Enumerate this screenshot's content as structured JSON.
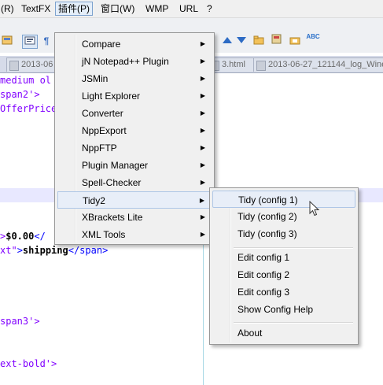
{
  "menubar": {
    "items": [
      "(R)",
      "TextFX",
      "插件(P)",
      "窗口(W)",
      "WMP",
      "URL",
      "?"
    ]
  },
  "toolbar": {
    "icons": [
      "save-all-icon",
      "print-icon",
      "paragraph-icon",
      "find-prev-icon",
      "find-next-icon",
      "folder-icon",
      "save-icon",
      "spellcheck-icon"
    ],
    "spellcheck_text": "ABC"
  },
  "tabs": [
    {
      "label": "2013-06"
    },
    {
      "label": "3.html"
    },
    {
      "label": "2013-06-27_121144_log_Wine"
    }
  ],
  "editor": {
    "lines": [
      {
        "parts": [
          {
            "text": "medium ol",
            "style": "purple"
          }
        ]
      },
      {
        "parts": [
          {
            "text": "span2'>",
            "style": "purple"
          }
        ]
      },
      {
        "parts": [
          {
            "text": "OfferPrice",
            "style": "purple"
          }
        ]
      },
      {
        "parts": [
          {
            "text": "",
            "style": "purple"
          }
        ]
      },
      {
        "parts": [
          {
            "text": "",
            "style": "purple"
          }
        ]
      },
      {
        "parts": [
          {
            "text": "",
            "style": "purple"
          }
        ]
      },
      {
        "parts": [
          {
            "text": ">",
            "style": "purple"
          },
          {
            "text": "$0.00",
            "style": "black"
          },
          {
            "text": "</",
            "style": "blue"
          }
        ]
      },
      {
        "parts": [
          {
            "text": "xt\"",
            "style": "purple"
          },
          {
            "text": ">",
            "style": "blue"
          },
          {
            "text": "shipping",
            "style": "black"
          },
          {
            "text": "</span>",
            "style": "blue"
          }
        ]
      },
      {
        "parts": [
          {
            "text": "span3'>",
            "style": "purple"
          }
        ]
      },
      {
        "parts": [
          {
            "text": "ext-bold'>",
            "style": "purple"
          }
        ]
      }
    ]
  },
  "plugin_menu": {
    "items": [
      {
        "label": "Compare"
      },
      {
        "label": "jN Notepad++ Plugin"
      },
      {
        "label": "JSMin"
      },
      {
        "label": "Light Explorer"
      },
      {
        "label": "Converter"
      },
      {
        "label": "NppExport"
      },
      {
        "label": "NppFTP"
      },
      {
        "label": "Plugin Manager"
      },
      {
        "label": "Spell-Checker"
      },
      {
        "label": "Tidy2"
      },
      {
        "label": "XBrackets Lite"
      },
      {
        "label": "XML Tools"
      }
    ],
    "submenu_arrow": "▶"
  },
  "tidy_submenu": {
    "items": [
      {
        "label": "Tidy (config 1)"
      },
      {
        "label": "Tidy (config 2)"
      },
      {
        "label": "Tidy (config 3)"
      },
      {
        "label": "Edit config 1"
      },
      {
        "label": "Edit config 2"
      },
      {
        "label": "Edit config 3"
      },
      {
        "label": "Show Config Help"
      },
      {
        "label": "About"
      }
    ]
  }
}
